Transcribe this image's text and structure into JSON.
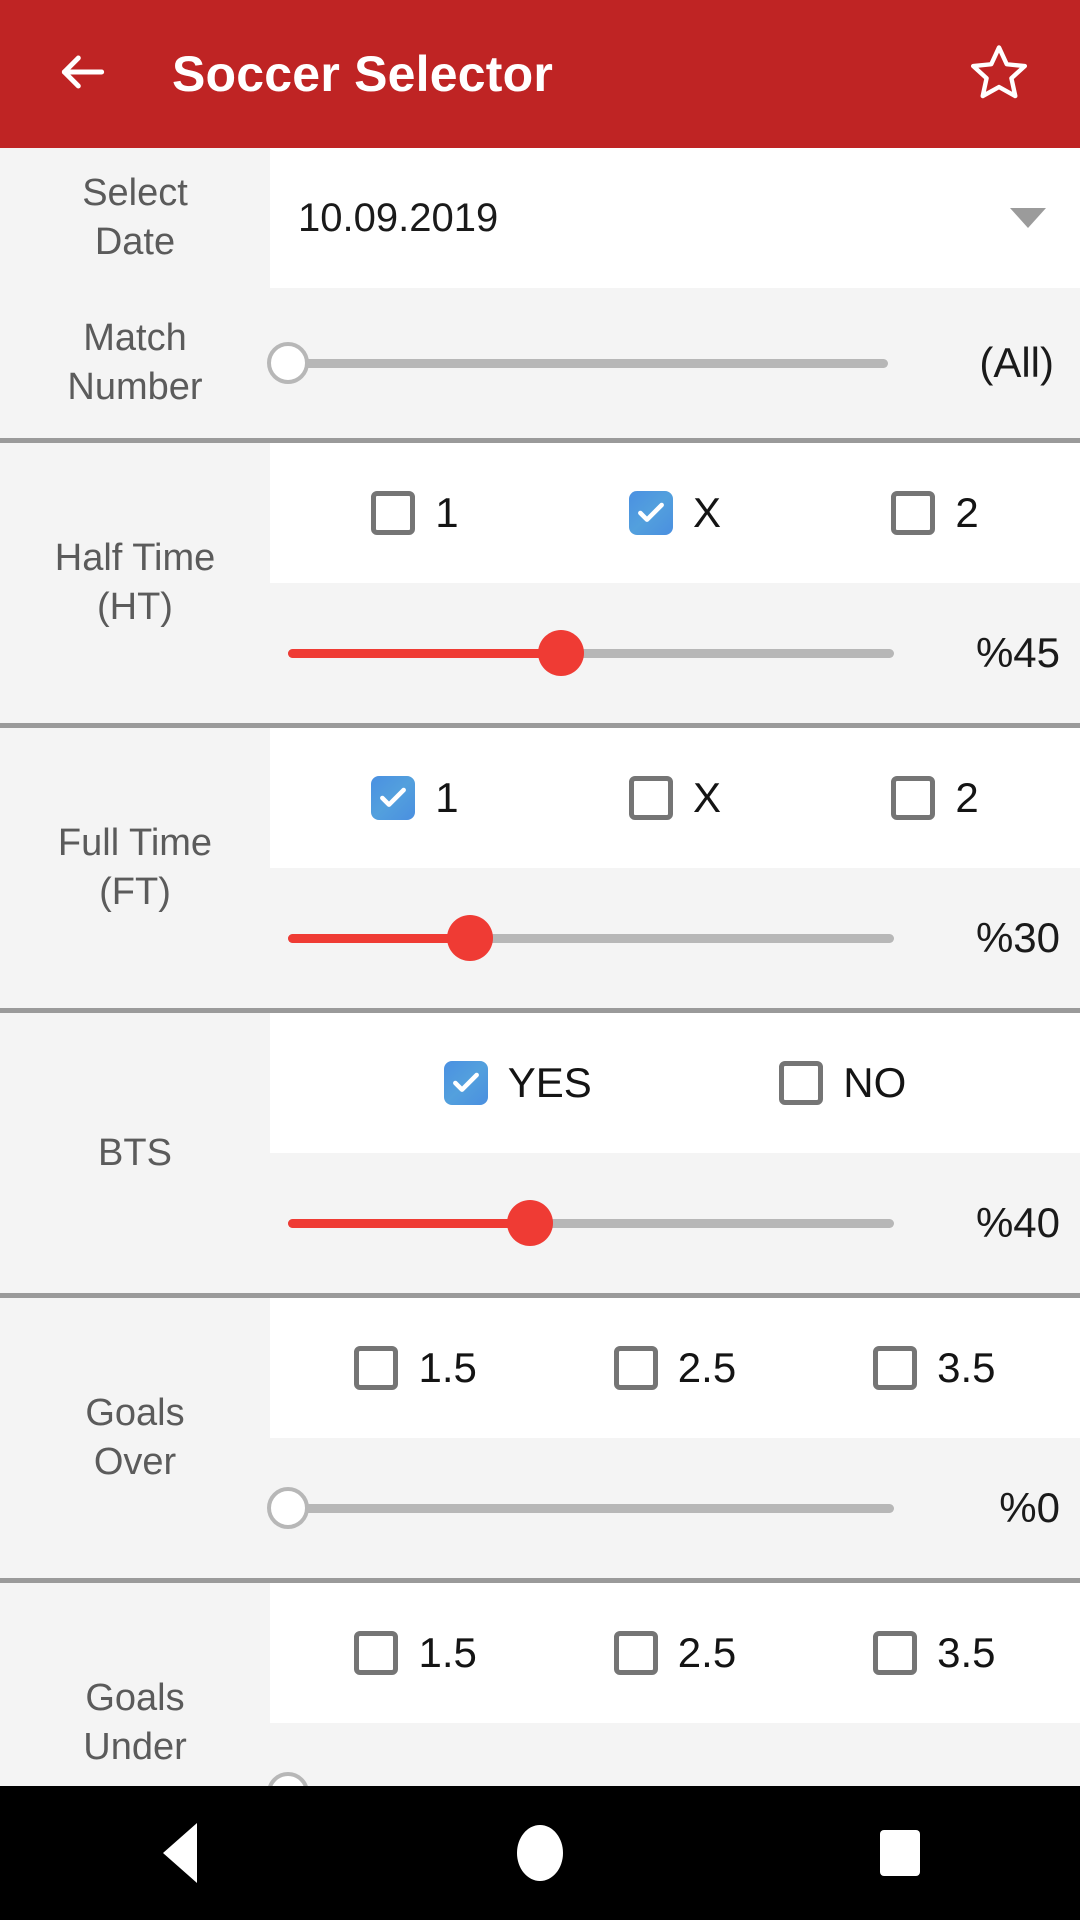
{
  "appbar": {
    "title": "Soccer Selector",
    "back_icon": "arrow-left-icon",
    "favorite_icon": "star-outline-icon",
    "background": "#bf2424",
    "text_color": "#ffffff"
  },
  "accent": {
    "slider_active": "#ef3b34",
    "slider_track": "#b7b7b7",
    "checkbox_checked": "#4a90e2",
    "checkbox_border": "#757575",
    "divider": "#9a9a9a"
  },
  "sections": {
    "select_date": {
      "label": "Select\nDate",
      "label_line1": "Select",
      "label_line2": "Date",
      "value": "10.09.2019",
      "dropdown_icon": "chevron-down-icon"
    },
    "match_number": {
      "label_line1": "Match",
      "label_line2": "Number",
      "value": "(All)",
      "slider_percent": 0
    },
    "half_time": {
      "label_line1": "Half Time",
      "label_line2": "(HT)",
      "options": [
        {
          "label": "1",
          "checked": false
        },
        {
          "label": "X",
          "checked": true
        },
        {
          "label": "2",
          "checked": false
        }
      ],
      "slider_value": "%45",
      "slider_percent": 45
    },
    "full_time": {
      "label_line1": "Full Time",
      "label_line2": "(FT)",
      "options": [
        {
          "label": "1",
          "checked": true
        },
        {
          "label": "X",
          "checked": false
        },
        {
          "label": "2",
          "checked": false
        }
      ],
      "slider_value": "%30",
      "slider_percent": 30
    },
    "bts": {
      "label_line1": "BTS",
      "label_line2": "",
      "options": [
        {
          "label": "YES",
          "checked": true
        },
        {
          "label": "NO",
          "checked": false
        }
      ],
      "slider_value": "%40",
      "slider_percent": 40
    },
    "goals_over": {
      "label_line1": "Goals",
      "label_line2": "Over",
      "options": [
        {
          "label": "1.5",
          "checked": false
        },
        {
          "label": "2.5",
          "checked": false
        },
        {
          "label": "3.5",
          "checked": false
        }
      ],
      "slider_value": "%0",
      "slider_percent": 0
    },
    "goals_under": {
      "label_line1": "Goals",
      "label_line2": "Under",
      "options": [
        {
          "label": "1.5",
          "checked": false
        },
        {
          "label": "2.5",
          "checked": false
        },
        {
          "label": "3.5",
          "checked": false
        }
      ]
    }
  },
  "navbar": {
    "back_icon": "triangle-back-icon",
    "home_icon": "circle-home-icon",
    "recents_icon": "square-recents-icon"
  }
}
